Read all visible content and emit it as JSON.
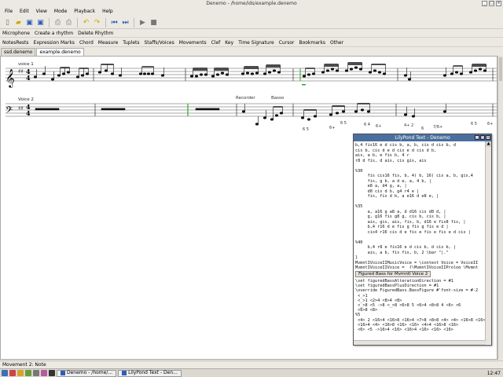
{
  "window": {
    "title": "Denemo - /home/ids/example.denemo"
  },
  "menubar": [
    "File",
    "Edit",
    "View",
    "Mode",
    "Playback",
    "Help"
  ],
  "toolbar": {
    "buttons": [
      "new-icon",
      "open-icon",
      "save-icon",
      "save-as-icon",
      "print-icon",
      "print-preview-icon",
      "undo-icon",
      "redo-icon",
      "first-icon",
      "last-icon",
      "play-icon",
      "stop-icon"
    ]
  },
  "row1": [
    "Microphone",
    "Create a rhythm",
    "Delete Rhythm"
  ],
  "row2": [
    "NotesRests",
    "Expression Marks",
    "Chord",
    "Measure",
    "Tuplets",
    "Staffs/Voices",
    "Movements",
    "Clef",
    "Key",
    "Time Signature",
    "Cursor",
    "Bookmarks",
    "Other"
  ],
  "tabs": [
    {
      "label": "ssd.denemo",
      "active": false
    },
    {
      "label": "example.denemo",
      "active": true
    }
  ],
  "score": {
    "staff1_label": "voice 1",
    "staff2_label": "Voice 2",
    "recorder_label": "Recorder",
    "basso_label": "Basso",
    "time_sig_top": "4",
    "time_sig_bottom": "4",
    "figures": [
      "6 5",
      "6+",
      "6 5",
      "6 4",
      "6+",
      "4+ 2",
      "6",
      "7/6+",
      "6 5",
      "6+"
    ]
  },
  "lilypond": {
    "title": "LilyPond Text - Denemo",
    "text_top": "b,4 fis16 e d cis b, a, b, cis d cis b, d\ncis b, cis d e d cis e d cis d b,\nais, a b, e fis b, 4 r\nr8 d fis, d ais, cis gis, ais\n\n%30\n     fis cis16 fis, b, 4( b, 16) cis a, b, gis,4\n     fis, g b, a d e, a, 4 b, |\n     e8 a, d4 g, a, |\n     d8 cis d b, g4 r4 e |\n     fis, fis d b, a e16 d e8 e, |\n\n%35\n     a, a16 g a8 a, d d16 cis d8 d, |\n     g, g16 fis g8 g, cis b, cis b, |\n     ais, gis, ais, fis, b, d16 e fis8 fis, |\n     b,4 r16 d e fis g fis g fis e d |\n     cis4 r16 cis d e fis e fis e fis e d cis |\n\n%40\n     b,4 r8 e fis16 e d cis b, d cis b, |\n     ais, a b, fis fis, b, 2 \\bar \"|.\"\n}\nMvmntIVoiceIIMusicVoice = \\context Voice = VoiceII\nMvmntIVoiceIIVoice =  {\\MvmntIVoiceIIProlog \\Mvmnt",
    "tab_label": "Figured Bass for MvmntI Voice 2",
    "text_bottom": "\\set figuredBassAlterationDirection = #1\n\\set figuredBassPlusDirection = #1\n\\override FiguredBass.BassFigure #'font-size = #-2\n <_>1\n <_>1 <2>4 <8>4 <8>\n <_>8 <5 ->8 <_>8 <6>8 5 <6>4 <8>8 4 <6> <6\n <6>8 <8>\n%5\n <4> 2 <16>4 <16>8 <16>4 <7>8 <8>8 <4> <4> <16>8 <16> <1\n <16>4 <4> <16>8 <16> <16> <4>4 <16>8 <16>\n <6> <5 ->16>4 <16> <16>4 <16> <16> <16>"
  },
  "status": {
    "text": "Movement 2: Note"
  },
  "taskbar": {
    "items": [
      "Denemo - /home/...",
      "LilyPond Text - Den..."
    ],
    "clock": "12:47"
  }
}
